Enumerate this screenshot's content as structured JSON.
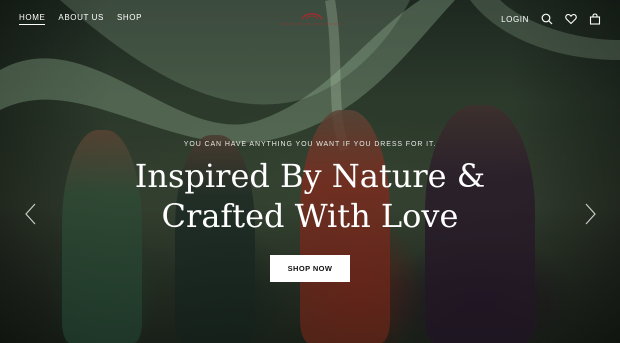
{
  "nav": {
    "links": [
      {
        "label": "HOME",
        "active": true
      },
      {
        "label": "ABOUT US",
        "active": false
      },
      {
        "label": "SHOP",
        "active": false
      }
    ],
    "login_label": "LOGIN",
    "icons": [
      "search-icon",
      "heart-icon",
      "shopping-bag-icon"
    ]
  },
  "logo": {
    "icon": "brand-logo"
  },
  "hero": {
    "tagline": "YOU CAN HAVE ANYTHING YOU WANT IF YOU DRESS FOR IT.",
    "headline_line1": "Inspired By Nature &",
    "headline_line2": "Crafted With Love",
    "cta_label": "SHOP NOW",
    "prev_icon": "chevron-left-icon",
    "next_icon": "chevron-right-icon"
  },
  "colors": {
    "accent_logo": "#b3262a",
    "cta_background": "#ffffff",
    "cta_text": "#111111"
  }
}
